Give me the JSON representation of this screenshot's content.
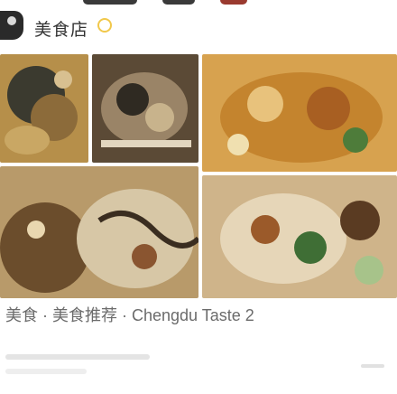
{
  "header": {
    "app_name": "美食店",
    "avatar_icon": "user-avatar-icon",
    "verified_icon": "verified-badge-icon",
    "accent_color": "#f1c84b"
  },
  "photos": {
    "count": 5,
    "items": [
      {
        "alt": "cooked-dish-1"
      },
      {
        "alt": "cooked-dish-2"
      },
      {
        "alt": "fried-food-3"
      },
      {
        "alt": "noodle-dish-4"
      },
      {
        "alt": "vegetable-dish-5"
      }
    ]
  },
  "post": {
    "caption": "美食 · 美食推荐 · Chengdu Taste 2"
  }
}
